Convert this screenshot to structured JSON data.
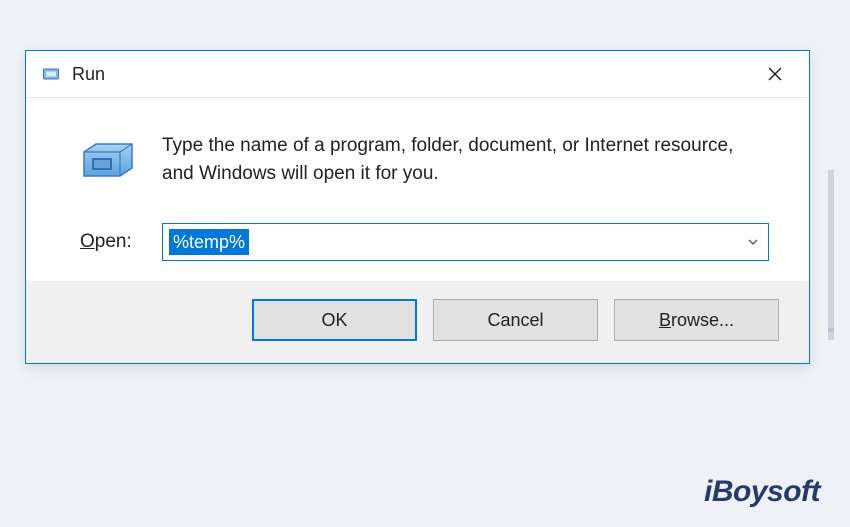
{
  "dialog": {
    "title": "Run",
    "description": "Type the name of a program, folder, document, or Internet resource, and Windows will open it for you.",
    "open_label_underline": "O",
    "open_label_rest": "pen:",
    "input_value": "%temp%",
    "buttons": {
      "ok": "OK",
      "cancel": "Cancel",
      "browse_underline": "B",
      "browse_rest": "rowse..."
    }
  },
  "watermark": "iBoysoft"
}
